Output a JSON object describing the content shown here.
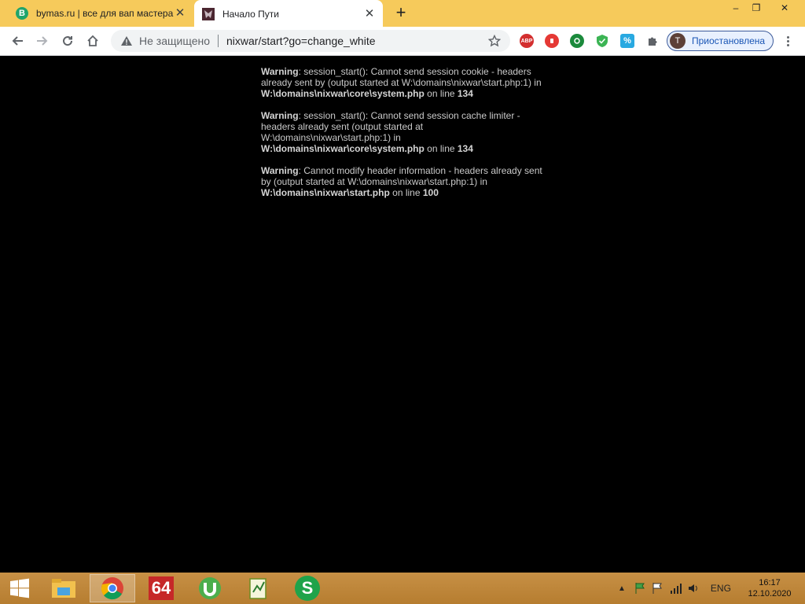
{
  "tabs": [
    {
      "favicon": "B",
      "title": "bymas.ru | все для вап мастера",
      "close": "✕"
    },
    {
      "title": "Начало Пути",
      "close": "✕"
    }
  ],
  "new_tab": "+",
  "window_controls": {
    "minimize": "–",
    "restore": "❐",
    "close": "✕"
  },
  "omnibox": {
    "security": "Не защищено",
    "url": "nixwar/start?go=change_white"
  },
  "extensions": [
    {
      "name": "adblock-plus-icon",
      "label": "ABP",
      "color": "#d32f2f"
    },
    {
      "name": "stop-hand-icon",
      "label": "",
      "color": "#e53935"
    },
    {
      "name": "green-robot-icon",
      "label": "",
      "color": "#1b8a3c"
    },
    {
      "name": "shield-check-icon",
      "label": "",
      "color": "#3bb454"
    },
    {
      "name": "percent-icon",
      "label": "%",
      "color": "#29a9e1"
    },
    {
      "name": "puzzle-icon",
      "label": "",
      "color": "#5f6368"
    }
  ],
  "profile": {
    "initial": "T",
    "label": "Приостановлена"
  },
  "warnings": [
    {
      "prefix": "Warning",
      "message": ": session_start(): Cannot send session cookie - headers already sent by (output started at W:\\domains\\nixwar\\start.php:1) in ",
      "file": "W:\\domains\\nixwar\\core\\system.php",
      "on_line": " on line ",
      "line": "134"
    },
    {
      "prefix": "Warning",
      "message": ": session_start(): Cannot send session cache limiter - headers already sent (output started at W:\\domains\\nixwar\\start.php:1) in ",
      "file": "W:\\domains\\nixwar\\core\\system.php",
      "on_line": " on line ",
      "line": "134"
    },
    {
      "prefix": "Warning",
      "message": ": Cannot modify header information - headers already sent by (output started at W:\\domains\\nixwar\\start.php:1) in ",
      "file": "W:\\domains\\nixwar\\start.php",
      "on_line": " on line ",
      "line": "100"
    }
  ],
  "taskbar": {
    "apps": [
      {
        "name": "windows-start-icon"
      },
      {
        "name": "file-explorer-icon"
      },
      {
        "name": "chrome-icon"
      },
      {
        "name": "aida64-icon",
        "label": "64"
      },
      {
        "name": "utorrent-icon"
      },
      {
        "name": "notepad-plus-icon"
      },
      {
        "name": "s-app-icon",
        "label": "S"
      }
    ],
    "language": "ENG",
    "time": "16:17",
    "date": "12.10.2020"
  }
}
